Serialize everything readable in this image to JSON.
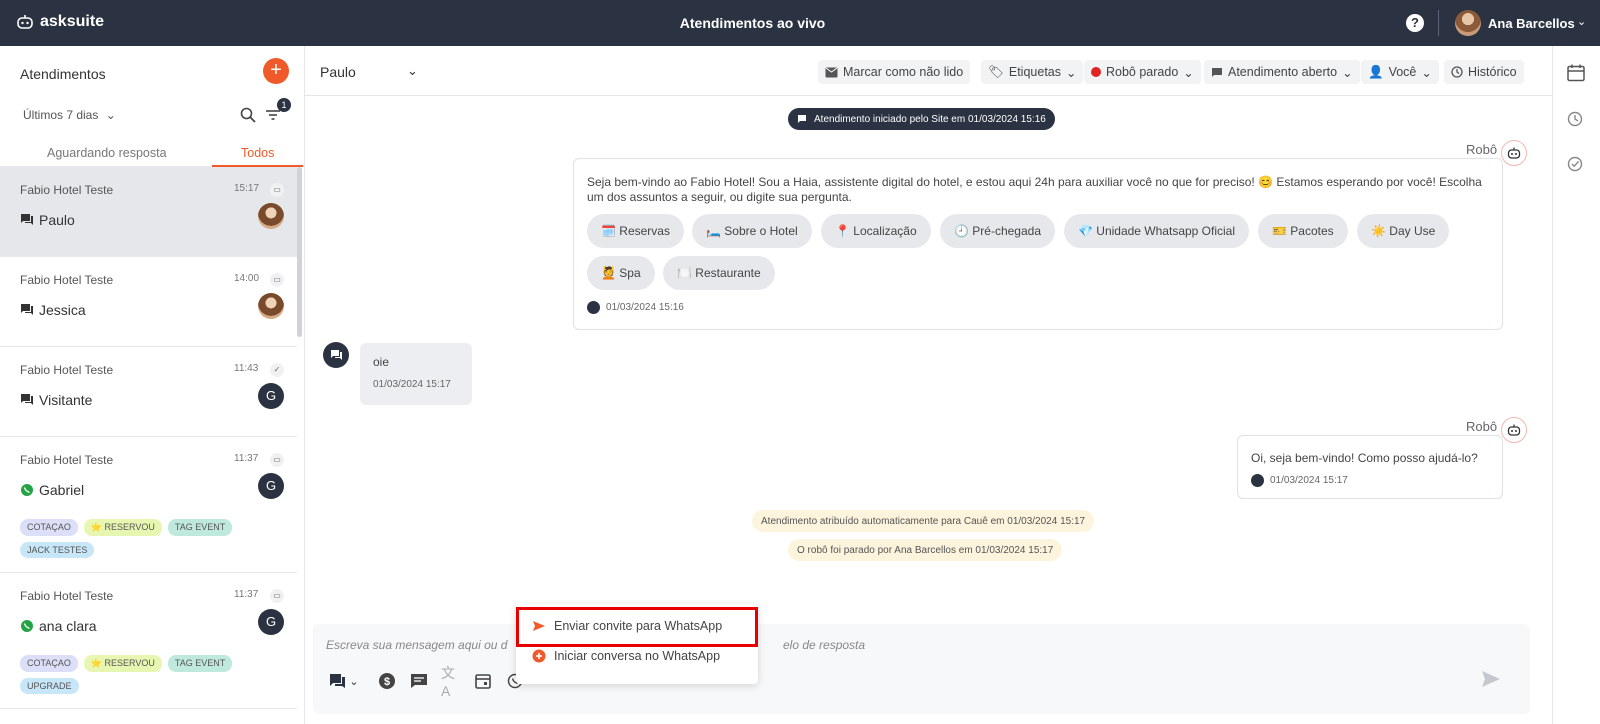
{
  "topbar": {
    "brand": "asksuite",
    "title": "Atendimentos ao vivo",
    "help": "?",
    "user_name": "Ana Barcellos"
  },
  "sidebar": {
    "title": "Atendimentos",
    "add": "+",
    "period": "Últimos 7 dias",
    "filter_count": "1",
    "tabs": [
      "Aguardando resposta",
      "Todos"
    ],
    "conversations": [
      {
        "hotel": "Fabio Hotel Teste",
        "time": "15:17",
        "name": "Paulo",
        "channel": "chat-icon",
        "avatar": "photo",
        "status_icon": "chat-bubble-icon"
      },
      {
        "hotel": "Fabio Hotel Teste",
        "time": "14:00",
        "name": "Jessica",
        "channel": "chat-icon",
        "avatar": "photo",
        "status_icon": "chat-bubble-icon"
      },
      {
        "hotel": "Fabio Hotel Teste",
        "time": "11:43",
        "name": "Visitante",
        "channel": "chat-icon",
        "avatar": "G",
        "status_icon": "check-icon"
      },
      {
        "hotel": "Fabio Hotel Teste",
        "time": "11:37",
        "name": "Gabriel",
        "channel": "whatsapp-icon",
        "avatar": "G",
        "status_icon": "chat-bubble-icon",
        "tags": [
          "COTAÇAO",
          "⭐ RESERVOU",
          "TAG EVENT",
          "JACK TESTES"
        ]
      },
      {
        "hotel": "Fabio Hotel Teste",
        "time": "11:37",
        "name": "ana clara",
        "channel": "whatsapp-icon",
        "avatar": "G",
        "status_icon": "chat-bubble-icon",
        "tags": [
          "COTAÇAO",
          "⭐ RESERVOU",
          "TAG EVENT",
          "UPGRADE"
        ]
      }
    ]
  },
  "header": {
    "contact": "Paulo",
    "actions": {
      "mark_unread": "Marcar como não lido",
      "tags": "Etiquetas",
      "robot": "Robô parado",
      "status": "Atendimento aberto",
      "assignee": "Você",
      "history": "Histórico"
    }
  },
  "chat": {
    "start_pill": "Atendimento iniciado pelo Site em 01/03/2024 15:16",
    "robot_label": "Robô",
    "welcome_text": "Seja bem-vindo ao Fabio Hotel! Sou a Haia, assistente digital do hotel, e estou aqui 24h para auxiliar você no que for preciso! 😊 Estamos esperando por você! Escolha um dos assuntos a seguir, ou digite sua pergunta.",
    "options": [
      "🗓️ Reservas",
      "🛏️ Sobre o Hotel",
      "📍 Localização",
      "🕘 Pré-chegada",
      "💎 Unidade Whatsapp Oficial",
      "🎫 Pacotes",
      "☀️ Day Use",
      "💆 Spa",
      "🍽️ Restaurante"
    ],
    "welcome_time": "01/03/2024 15:16",
    "user_msg": "oie",
    "user_time": "01/03/2024 15:17",
    "robot_label2": "Robô",
    "reply_text": "Oi, seja bem-vindo! Como posso ajudá-lo?",
    "reply_time": "01/03/2024 15:17",
    "sys1": "Atendimento atribuído automaticamente para Cauê em 01/03/2024 15:17",
    "sys2": "O robô foi parado por Ana Barcellos em 01/03/2024 15:17"
  },
  "composer": {
    "placeholder_start": "Escreva sua mensagem aqui ou d",
    "placeholder_end": "elo de resposta"
  },
  "popup": {
    "items": [
      "Enviar convite para WhatsApp",
      "Iniciar conversa no WhatsApp"
    ]
  },
  "colors": {
    "brand_orange": "#f05a2a",
    "topbar": "#2b3342",
    "highlight": "#e60000"
  }
}
